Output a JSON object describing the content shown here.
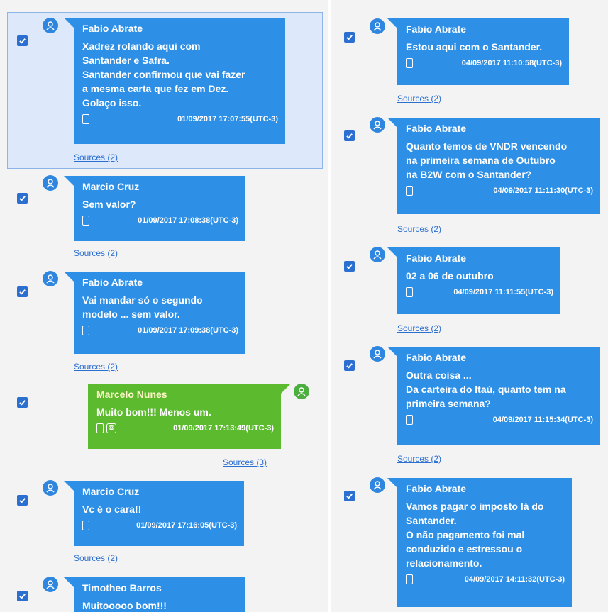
{
  "left_column": {
    "messages": [
      {
        "sender": "Fabio Abrate",
        "text": "Xadrez rolando aqui com\nSantander e Safra.\nSantander confirmou que vai fazer\na mesma carta que fez em Dez.\nGolaço isso.",
        "timestamp": "01/09/2017 17:07:55(UTC-3)",
        "sources": "Sources (2)",
        "selected": true,
        "color": "#2e8fe6"
      },
      {
        "sender": "Marcio Cruz",
        "text": "Sem valor?",
        "timestamp": "01/09/2017 17:08:38(UTC-3)",
        "sources": "Sources (2)",
        "color": "#2e8fe6"
      },
      {
        "sender": "Fabio Abrate",
        "text": "Vai mandar só o segundo\nmodelo ... sem valor.",
        "timestamp": "01/09/2017 17:09:38(UTC-3)",
        "sources": "Sources (2)",
        "color": "#2e8fe6"
      },
      {
        "sender": "Marcelo Nunes",
        "text": "Muito bom!!! Menos um.",
        "timestamp": "01/09/2017 17:13:49(UTC-3)",
        "sources": "Sources (3)",
        "color": "#5cba2f",
        "outgoing": true
      },
      {
        "sender": "Marcio Cruz",
        "text": "Vc é o cara!!",
        "timestamp": "01/09/2017 17:16:05(UTC-3)",
        "sources": "Sources (2)",
        "color": "#2e8fe6"
      },
      {
        "sender": "Timotheo Barros",
        "text": "Muitooooo bom!!!",
        "color": "#2e8fe6"
      }
    ]
  },
  "right_column": {
    "messages": [
      {
        "sender": "Fabio Abrate",
        "text": "Estou aqui com o Santander.",
        "timestamp": "04/09/2017 11:10:58(UTC-3)",
        "sources": "Sources (2)"
      },
      {
        "sender": "Fabio Abrate",
        "text": "Quanto temos de VNDR vencendo\nna primeira semana de Outubro\nna B2W com o Santander?",
        "timestamp": "04/09/2017 11:11:30(UTC-3)",
        "sources": "Sources (2)"
      },
      {
        "sender": "Fabio Abrate",
        "text": "02 a 06 de outubro",
        "timestamp": "04/09/2017 11:11:55(UTC-3)",
        "sources": "Sources (2)"
      },
      {
        "sender": "Fabio Abrate",
        "text": "Outra coisa ...\nDa carteira do Itaú, quanto tem na\nprimeira semana?",
        "timestamp": "04/09/2017 11:15:34(UTC-3)",
        "sources": "Sources (2)"
      },
      {
        "sender": "Fabio Abrate",
        "text": "Vamos pagar o imposto lá do\nSantander.\nO não pagamento foi mal\nconduzido e estressou o\nrelacionamento.",
        "timestamp": "04/09/2017 14:11:32(UTC-3)"
      }
    ]
  },
  "icons": {
    "checkbox": "checkmark-icon",
    "avatar": "user-avatar-icon",
    "device": "phone-icon",
    "group": "group-icon"
  }
}
